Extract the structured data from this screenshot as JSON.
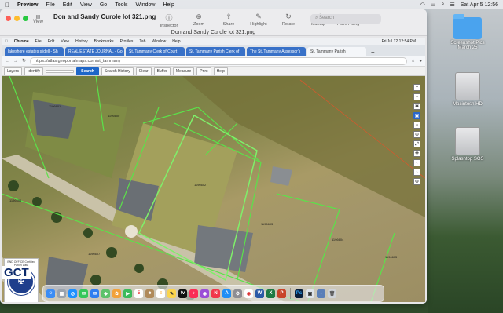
{
  "menubar": {
    "app": "Preview",
    "items": [
      "File",
      "Edit",
      "View",
      "Go",
      "Tools",
      "Window",
      "Help"
    ],
    "clock": "Sat Apr 5  12:56"
  },
  "preview": {
    "view_label": "View",
    "title": "Don and Sandy Curole lot 321.png",
    "subtitle": "",
    "filename": "Don and Sandy Curole lot 321.png",
    "tools": [
      "Inspector",
      "Zoom",
      "Share",
      "Highlight",
      "Rotate",
      "Markup",
      "Form Filling"
    ],
    "search_placeholder": "Search"
  },
  "captured": {
    "menu": [
      "Chrome",
      "File",
      "Edit",
      "View",
      "History",
      "Bookmarks",
      "Profiles",
      "Tab",
      "Window",
      "Help"
    ],
    "clock": "Fri Jul 12  12:54 PM",
    "tabs": [
      "lakeshore estates slidell - Sh",
      "REAL ESTATE JOURNAL - Go",
      "St. Tammany Clerk of Court",
      "St. Tammany Parish Clerk of",
      "The St. Tammany Assessor's",
      "St. Tammany Parish"
    ],
    "url": "https://atlas.geoportalmaps.com/st_tammany",
    "gis_buttons": [
      "Layers",
      "Identify",
      "Search",
      "Search History",
      "Clear",
      "Buffer",
      "Measure",
      "Print",
      "Help"
    ],
    "search_placeholder": "",
    "search_button": "Search",
    "lot_labels": [
      "1196600",
      "1196601",
      "1196602",
      "1196603",
      "1196604",
      "1196605",
      "1196606",
      "1196607"
    ],
    "logo_caption": "BND OFFICE Certified Parcel Data",
    "gct": "GCT"
  },
  "desktop": {
    "icons": [
      {
        "label": "Screenshot Pics",
        "sub": "March 25",
        "icon": "folder-icon"
      },
      {
        "label": "Macintosh HD",
        "icon": "hard-drive-icon"
      },
      {
        "label": "Splashtop SOS",
        "icon": "hard-drive-icon"
      }
    ]
  },
  "dock": {
    "apps": [
      "finder",
      "launchpad",
      "safari",
      "messages",
      "mail",
      "maps",
      "photos",
      "facetime",
      "calendar",
      "contacts",
      "reminders",
      "notes",
      "tv",
      "music",
      "podcasts",
      "news",
      "app-store",
      "settings",
      "chrome",
      "word",
      "excel",
      "powerpoint",
      "photoshop",
      "preview",
      "downloads",
      "trash"
    ]
  }
}
